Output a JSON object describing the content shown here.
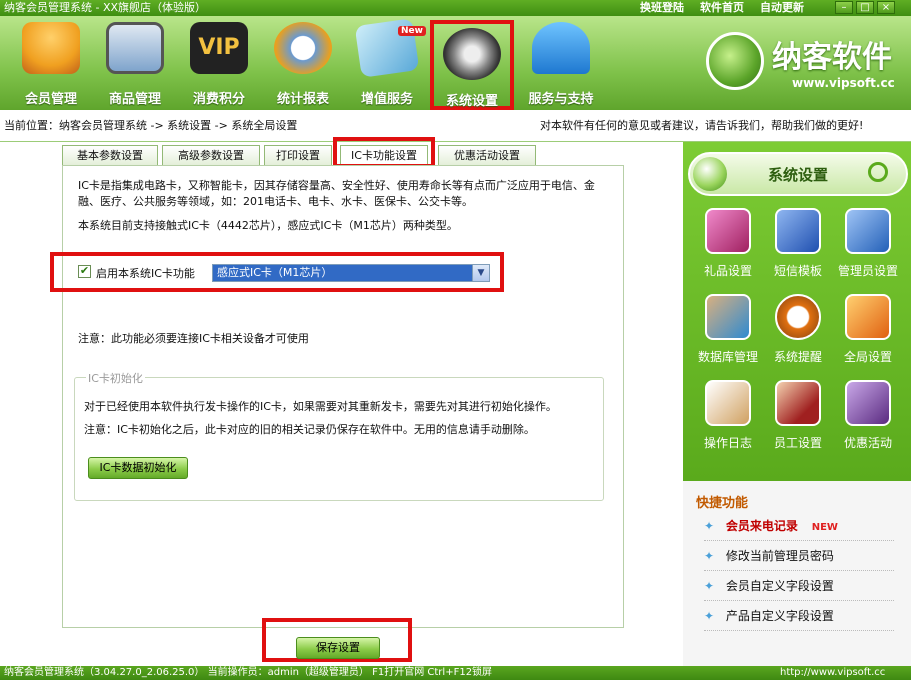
{
  "titlebar": {
    "title": "纳客会员管理系统 - XX旗舰店（体验版）",
    "links": [
      "换班登陆",
      "软件首页",
      "自动更新"
    ]
  },
  "toolbar": [
    {
      "label": "会员管理",
      "icon": "members-icon",
      "color": "#f0a020"
    },
    {
      "label": "商品管理",
      "icon": "products-icon",
      "color": "#4a7ab0"
    },
    {
      "label": "消费积分",
      "icon": "vip-icon",
      "color": "#222222"
    },
    {
      "label": "统计报表",
      "icon": "clock-chart-icon",
      "color": "#e8a020"
    },
    {
      "label": "增值服务",
      "icon": "money-icon",
      "color": "#58a8d8",
      "badge": "New"
    },
    {
      "label": "系统设置",
      "icon": "gear-icon",
      "color": "#666666",
      "selected": true
    },
    {
      "label": "服务与支持",
      "icon": "umbrella-icon",
      "color": "#1e90e0"
    }
  ],
  "logo": {
    "name": "纳客软件",
    "url": "www.vipsoft.cc"
  },
  "breadcrumb": {
    "path": "当前位置：纳客会员管理系统 -> 系统设置 -> 系统全局设置",
    "feedback": "对本软件有任何的意见或者建议，请告诉我们，帮助我们做的更好!"
  },
  "tabs": [
    "基本参数设置",
    "高级参数设置",
    "打印设置",
    "IC卡功能设置",
    "优惠活动设置"
  ],
  "active_tab": "IC卡功能设置",
  "ic": {
    "intro1": "IC卡是指集成电路卡，又称智能卡，因其存储容量高、安全性好、使用寿命长等有点而广泛应用于电信、金融、医疗、公共服务等领域，如：201电话卡、电卡、水卡、医保卡、公交卡等。",
    "intro2": "本系统目前支持接触式IC卡（4442芯片），感应式IC卡（M1芯片）两种类型。",
    "enable_label": "启用本系统IC卡功能",
    "enable_checked": true,
    "card_type": "感应式IC卡（M1芯片）",
    "note": "注意：此功能必须要连接IC卡相关设备才可使用",
    "init_legend": "IC卡初始化",
    "init_text1": "对于已经使用本软件执行发卡操作的IC卡，如果需要对其重新发卡，需要先对其进行初始化操作。",
    "init_text2": "注意：IC卡初始化之后，此卡对应的旧的相关记录仍保存在软件中。无用的信息请手动删除。",
    "init_button": "IC卡数据初始化",
    "save_button": "保存设置"
  },
  "right_panel": {
    "title": "系统设置",
    "items": [
      {
        "label": "礼品设置",
        "icon": "gift-icon",
        "color": "#c03080"
      },
      {
        "label": "短信模板",
        "icon": "sms-icon",
        "color": "#2a60c0"
      },
      {
        "label": "管理员设置",
        "icon": "admin-lock-icon",
        "color": "#3070c8"
      },
      {
        "label": "数据库管理",
        "icon": "database-icon",
        "color": "#2f8ad0"
      },
      {
        "label": "系统提醒",
        "icon": "alarm-clock-icon",
        "color": "#e07010"
      },
      {
        "label": "全局设置",
        "icon": "global-settings-icon",
        "color": "#e09020"
      },
      {
        "label": "操作日志",
        "icon": "log-icon",
        "color": "#c08040"
      },
      {
        "label": "员工设置",
        "icon": "employee-icon",
        "color": "#a02020"
      },
      {
        "label": "优惠活动",
        "icon": "promotion-icon",
        "color": "#7a4aa0"
      }
    ],
    "quick_title": "快捷功能",
    "quick": [
      {
        "label": "会员来电记录",
        "badge": "NEW",
        "color": "#c00000"
      },
      {
        "label": "修改当前管理员密码"
      },
      {
        "label": "会员自定义字段设置"
      },
      {
        "label": "产品自定义字段设置"
      }
    ]
  },
  "status": {
    "text": "纳客会员管理系统（3.04.27.0_2.06.25.0） 当前操作员：admin（超级管理员） F1打开官网 Ctrl+F12锁屏",
    "url": "http://www.vipsoft.cc"
  }
}
